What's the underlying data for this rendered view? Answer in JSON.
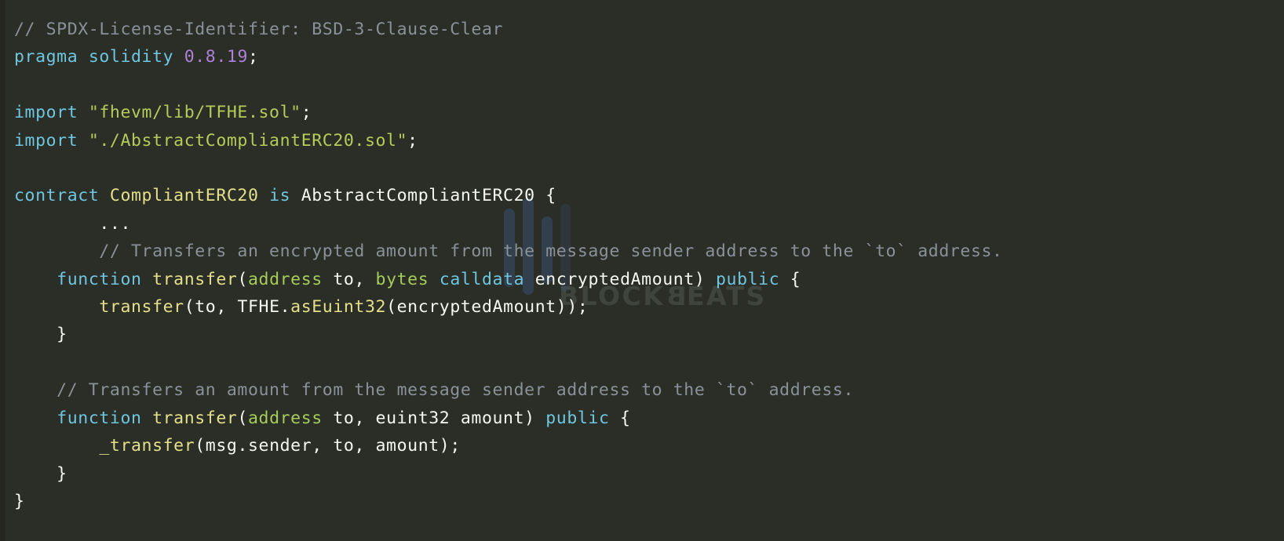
{
  "editor": {
    "language": "solidity",
    "background_color": "#2b2e27",
    "default_text_color": "#f7f7f2",
    "theme_colors": {
      "comment": "#8a9199",
      "keyword": "#6ec6e0",
      "string": "#b5cc5a",
      "number": "#ae81d8",
      "type_or_function": "#e4e08a",
      "builtin_type": "#a6cc5a",
      "plain": "#f7f7f2"
    }
  },
  "watermark": {
    "brand_text_left": "BLOCK",
    "brand_text_flipped_letter": "B",
    "brand_text_right": "EATS",
    "full_text": "BLOCKBEATS",
    "logo_name": "blockbeats-bars-logo",
    "color": "#6f7a72",
    "bar_color": "#3f5a86"
  },
  "code": {
    "lines": [
      {
        "id": 1,
        "tokens": [
          {
            "t": "// SPDX-License-Identifier: BSD-3-Clause-Clear",
            "c": "cmt"
          }
        ]
      },
      {
        "id": 2,
        "tokens": [
          {
            "t": "pragma",
            "c": "kw"
          },
          {
            "t": " ",
            "c": "pl"
          },
          {
            "t": "solidity",
            "c": "kw"
          },
          {
            "t": " ",
            "c": "pl"
          },
          {
            "t": "0.8.19",
            "c": "num"
          },
          {
            "t": ";",
            "c": "pl"
          }
        ]
      },
      {
        "id": 3,
        "tokens": []
      },
      {
        "id": 4,
        "tokens": [
          {
            "t": "import",
            "c": "kw"
          },
          {
            "t": " ",
            "c": "pl"
          },
          {
            "t": "\"fhevm/lib/TFHE.sol\"",
            "c": "str"
          },
          {
            "t": ";",
            "c": "pl"
          }
        ]
      },
      {
        "id": 5,
        "tokens": [
          {
            "t": "import",
            "c": "kw"
          },
          {
            "t": " ",
            "c": "pl"
          },
          {
            "t": "\"./AbstractCompliantERC20.sol\"",
            "c": "str"
          },
          {
            "t": ";",
            "c": "pl"
          }
        ]
      },
      {
        "id": 6,
        "tokens": []
      },
      {
        "id": 7,
        "tokens": [
          {
            "t": "contract",
            "c": "kw"
          },
          {
            "t": " ",
            "c": "pl"
          },
          {
            "t": "CompliantERC20",
            "c": "typ"
          },
          {
            "t": " ",
            "c": "pl"
          },
          {
            "t": "is",
            "c": "kw"
          },
          {
            "t": " AbstractCompliantERC20 {",
            "c": "pl"
          }
        ]
      },
      {
        "id": 8,
        "tokens": [
          {
            "t": "        ...",
            "c": "pl"
          }
        ]
      },
      {
        "id": 9,
        "tokens": [
          {
            "t": "        // Transfers an encrypted amount from the message sender address to the `to` address.",
            "c": "cmt"
          }
        ]
      },
      {
        "id": 10,
        "tokens": [
          {
            "t": "    ",
            "c": "pl"
          },
          {
            "t": "function",
            "c": "kw"
          },
          {
            "t": " ",
            "c": "pl"
          },
          {
            "t": "transfer",
            "c": "fn"
          },
          {
            "t": "(",
            "c": "pl"
          },
          {
            "t": "address",
            "c": "bi"
          },
          {
            "t": " to, ",
            "c": "pl"
          },
          {
            "t": "bytes",
            "c": "bi"
          },
          {
            "t": " ",
            "c": "pl"
          },
          {
            "t": "calldata",
            "c": "kw"
          },
          {
            "t": " encryptedAmount) ",
            "c": "pl"
          },
          {
            "t": "public",
            "c": "kw"
          },
          {
            "t": " {",
            "c": "pl"
          }
        ]
      },
      {
        "id": 11,
        "tokens": [
          {
            "t": "        ",
            "c": "pl"
          },
          {
            "t": "transfer",
            "c": "fn"
          },
          {
            "t": "(to, TFHE.",
            "c": "pl"
          },
          {
            "t": "asEuint32",
            "c": "fn"
          },
          {
            "t": "(encryptedAmount));",
            "c": "pl"
          }
        ]
      },
      {
        "id": 12,
        "tokens": [
          {
            "t": "    }",
            "c": "pl"
          }
        ]
      },
      {
        "id": 13,
        "tokens": []
      },
      {
        "id": 14,
        "tokens": [
          {
            "t": "    // Transfers an amount from the message sender address to the `to` address.",
            "c": "cmt"
          }
        ]
      },
      {
        "id": 15,
        "tokens": [
          {
            "t": "    ",
            "c": "pl"
          },
          {
            "t": "function",
            "c": "kw"
          },
          {
            "t": " ",
            "c": "pl"
          },
          {
            "t": "transfer",
            "c": "fn"
          },
          {
            "t": "(",
            "c": "pl"
          },
          {
            "t": "address",
            "c": "bi"
          },
          {
            "t": " to, euint32 amount) ",
            "c": "pl"
          },
          {
            "t": "public",
            "c": "kw"
          },
          {
            "t": " {",
            "c": "pl"
          }
        ]
      },
      {
        "id": 16,
        "tokens": [
          {
            "t": "        ",
            "c": "pl"
          },
          {
            "t": "_transfer",
            "c": "fn"
          },
          {
            "t": "(msg.sender, to, amount);",
            "c": "pl"
          }
        ]
      },
      {
        "id": 17,
        "tokens": [
          {
            "t": "    }",
            "c": "pl"
          }
        ]
      },
      {
        "id": 18,
        "tokens": [
          {
            "t": "}",
            "c": "pl"
          }
        ]
      }
    ]
  }
}
